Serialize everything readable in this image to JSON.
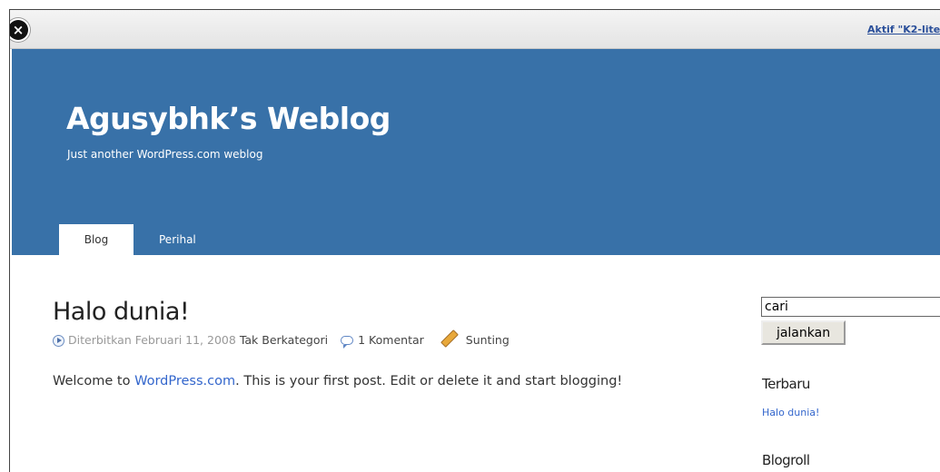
{
  "topbar": {
    "close_icon": "×",
    "notice": "Aktif \"K2-lite"
  },
  "header": {
    "site_title": "Agusybhk’s Weblog",
    "tagline": "Just another WordPress.com weblog",
    "background": "#3871a8"
  },
  "nav": {
    "tabs": [
      {
        "label": "Blog",
        "active": true
      },
      {
        "label": "Perihal",
        "active": false
      }
    ]
  },
  "post": {
    "title": "Halo dunia!",
    "meta": {
      "published_label": "Diterbitkan Februari 11, 2008",
      "category": "Tak Berkategori",
      "comments": "1 Komentar",
      "edit": "Sunting"
    },
    "body_before": "Welcome to ",
    "body_link": "WordPress.com",
    "body_after": ". This is your first post. Edit or delete it and start blogging!"
  },
  "sidebar": {
    "search_value": "cari",
    "search_button": "jalankan",
    "recent_title": "Terbaru",
    "recent_items": [
      "Halo dunia!"
    ],
    "blogroll_title": "Blogroll"
  }
}
